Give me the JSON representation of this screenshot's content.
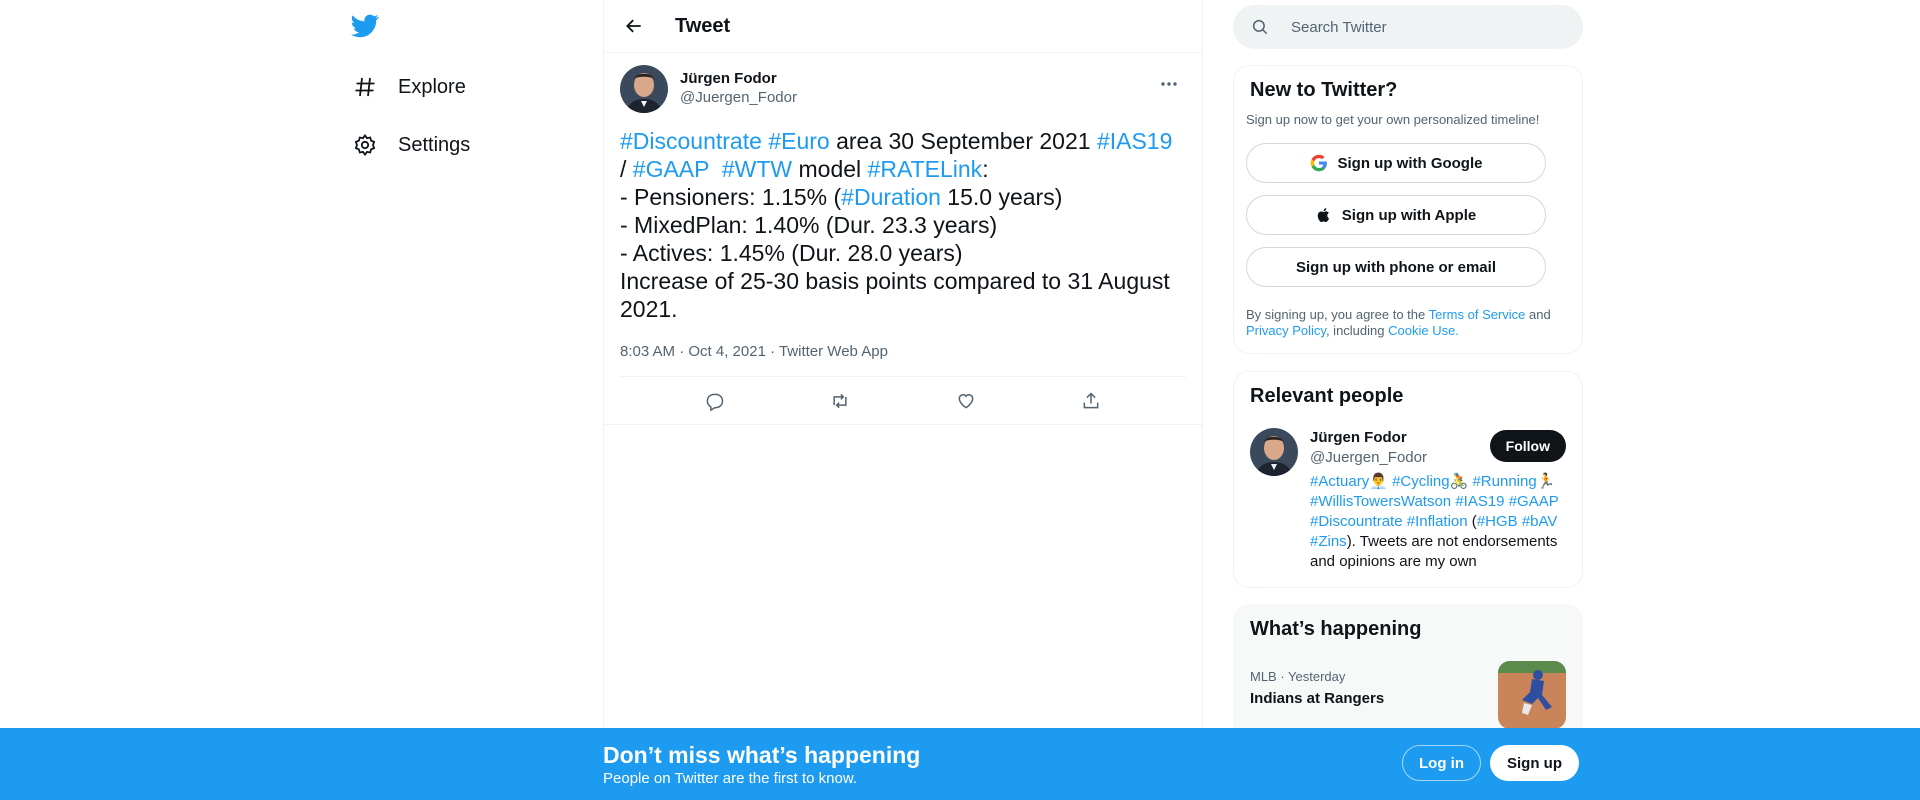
{
  "nav": {
    "logo": "twitter-bird-icon",
    "items": [
      {
        "label": "Explore",
        "icon": "hashtag-icon"
      },
      {
        "label": "Settings",
        "icon": "gear-icon"
      }
    ]
  },
  "main": {
    "title": "Tweet",
    "tweet": {
      "author_name": "Jürgen Fodor",
      "author_handle": "@Juergen_Fodor",
      "lines": [
        [
          {
            "t": "#Discountrate",
            "link": true
          },
          {
            "t": " "
          },
          {
            "t": "#Euro",
            "link": true
          },
          {
            "t": " area 30 September 2021 "
          },
          {
            "t": "#IAS19",
            "link": true
          }
        ],
        [
          {
            "t": "/ "
          },
          {
            "t": "#GAAP",
            "link": true
          },
          {
            "t": "  "
          },
          {
            "t": "#WTW",
            "link": true
          },
          {
            "t": " model "
          },
          {
            "t": "#RATELink",
            "link": true
          },
          {
            "t": ":"
          }
        ],
        [
          {
            "t": "- Pensioners: 1.15% ("
          },
          {
            "t": "#Duration",
            "link": true
          },
          {
            "t": " 15.0 years)"
          }
        ],
        [
          {
            "t": "- MixedPlan: 1.40% (Dur. 23.3 years)"
          }
        ],
        [
          {
            "t": "- Actives: 1.45% (Dur. 28.0 years)"
          }
        ],
        [
          {
            "t": "Increase of 25-30 basis points compared to 31 August"
          }
        ],
        [
          {
            "t": "2021."
          }
        ]
      ],
      "meta": "8:03 AM · Oct 4, 2021 · Twitter Web App",
      "actions": [
        "reply-icon",
        "retweet-icon",
        "like-icon",
        "share-icon"
      ]
    }
  },
  "search": {
    "placeholder": "Search Twitter"
  },
  "signup_card": {
    "title": "New to Twitter?",
    "subtitle": "Sign up now to get your own personalized timeline!",
    "google": "Sign up with Google",
    "apple": "Sign up with Apple",
    "phone": "Sign up with phone or email",
    "terms_1": "By signing up, you agree to the ",
    "terms_link_1": "Terms of Service",
    "terms_2": " and",
    "terms_link_2": "Privacy Policy",
    "terms_3": ", including ",
    "terms_link_3": "Cookie Use."
  },
  "people_card": {
    "title": "Relevant people",
    "name": "Jürgen Fodor",
    "handle": "@Juergen_Fodor",
    "follow": "Follow",
    "bio": [
      {
        "t": "#Actuary",
        "link": true
      },
      {
        "t": "👨‍💼 "
      },
      {
        "t": "#Cycling",
        "link": true
      },
      {
        "t": "🚴 "
      },
      {
        "t": "#Running",
        "link": true
      },
      {
        "t": "🏃 "
      },
      {
        "t": "#WillisTowersWatson",
        "link": true
      },
      {
        "t": " "
      },
      {
        "t": "#IAS19",
        "link": true
      },
      {
        "t": " "
      },
      {
        "t": "#GAAP",
        "link": true
      },
      {
        "t": " "
      },
      {
        "t": "#Discountrate",
        "link": true
      },
      {
        "t": " "
      },
      {
        "t": "#Inflation",
        "link": true
      },
      {
        "t": " ("
      },
      {
        "t": "#HGB",
        "link": true
      },
      {
        "t": " "
      },
      {
        "t": "#bAV",
        "link": true
      },
      {
        "t": " "
      },
      {
        "t": "#Zins",
        "link": true
      },
      {
        "t": "). Tweets are not endorsements and opinions are my own"
      }
    ]
  },
  "happening_card": {
    "title": "What’s happening",
    "trend_meta": "MLB · Yesterday",
    "trend_title": "Indians at Rangers"
  },
  "bottom_bar": {
    "title": "Don’t miss what’s happening",
    "subtitle": "People on Twitter are the first to know.",
    "login": "Log in",
    "signup": "Sign up"
  },
  "colors": {
    "accent": "#1d9bf0",
    "text": "#0f1419",
    "muted": "#536471"
  }
}
